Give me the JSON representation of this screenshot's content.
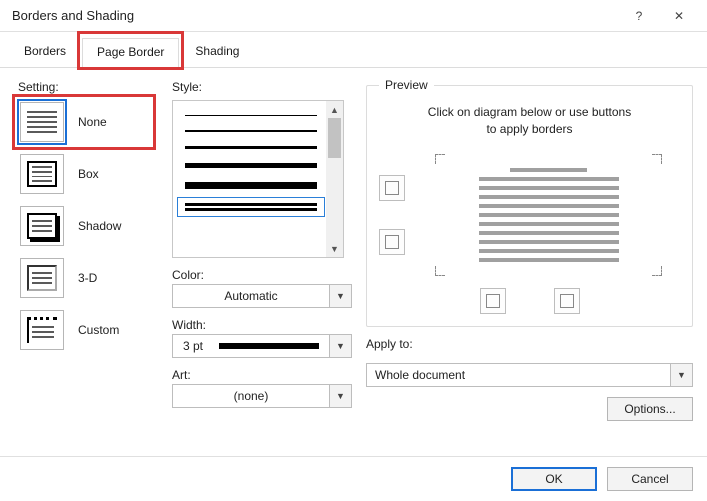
{
  "titlebar": {
    "title": "Borders and Shading",
    "help": "?",
    "close": "✕"
  },
  "tabs": {
    "borders": "Borders",
    "pageBorder": "Page Border",
    "shading": "Shading",
    "active": "Page Border"
  },
  "setting": {
    "label": "Setting:",
    "items": [
      {
        "value": "none",
        "label": "None"
      },
      {
        "value": "box",
        "label": "Box"
      },
      {
        "value": "shadow",
        "label": "Shadow"
      },
      {
        "value": "3d",
        "label": "3-D"
      },
      {
        "value": "custom",
        "label": "Custom"
      }
    ],
    "selected": "none"
  },
  "style": {
    "label": "Style:"
  },
  "color": {
    "label": "Color:",
    "value": "Automatic"
  },
  "width": {
    "label": "Width:",
    "value": "3 pt"
  },
  "art": {
    "label": "Art:",
    "value": "(none)"
  },
  "preview": {
    "label": "Preview",
    "hint1": "Click on diagram below or use buttons",
    "hint2": "to apply borders"
  },
  "applyTo": {
    "label": "Apply to:",
    "value": "Whole document"
  },
  "buttons": {
    "options": "Options...",
    "ok": "OK",
    "cancel": "Cancel"
  }
}
